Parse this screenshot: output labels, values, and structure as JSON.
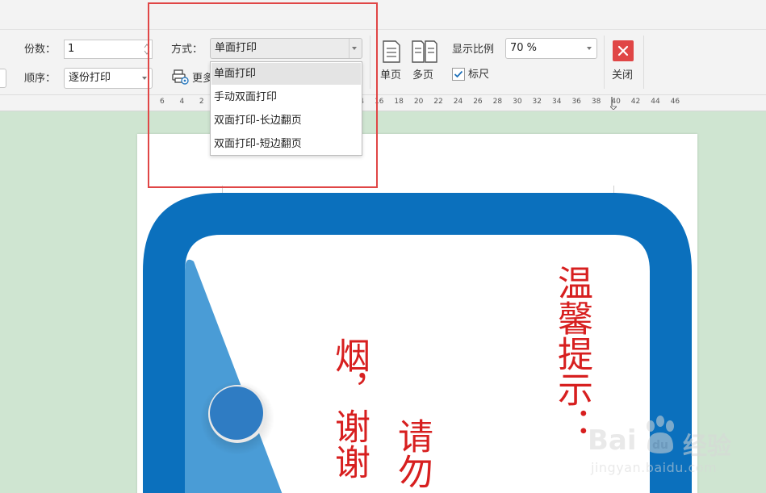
{
  "toolbar": {
    "copies_label": "份数：",
    "copies_value": "1",
    "order_label": "顺序：",
    "order_value": "逐份打印",
    "mode_label": "方式：",
    "mode_value": "单面打印",
    "more_settings_label": "更多",
    "single_page_label": "单页",
    "multi_page_label": "多页",
    "zoom_label": "显示比例",
    "zoom_value": "70 %",
    "ruler_label": "标尺",
    "ruler_checked": true,
    "close_label": "关闭"
  },
  "mode_dropdown": {
    "options": [
      "单面打印",
      "手动双面打印",
      "双面打印-长边翻页",
      "双面打印-短边翻页"
    ],
    "selected_index": 0
  },
  "ruler": {
    "ticks": [
      "6",
      "4",
      "2",
      "",
      "",
      "",
      "",
      "",
      "",
      "",
      "14",
      "16",
      "18",
      "20",
      "22",
      "24",
      "26",
      "28",
      "30",
      "32",
      "34",
      "36",
      "38",
      "40",
      "42",
      "44",
      "46"
    ]
  },
  "document": {
    "heading_text": "温馨提示：",
    "line2_text": "请勿",
    "line3_text": "烟，谢谢"
  },
  "watermark": {
    "brand": "Bai",
    "brand2": "经验",
    "url": "jingyan.baidu.com"
  },
  "colors": {
    "accent_blue": "#0b70bd",
    "light_blue": "#4a9cd6",
    "text_red": "#d71f1f",
    "highlight_red": "#e04646",
    "close_red": "#e04646",
    "background_green": "#cfe5d1"
  }
}
